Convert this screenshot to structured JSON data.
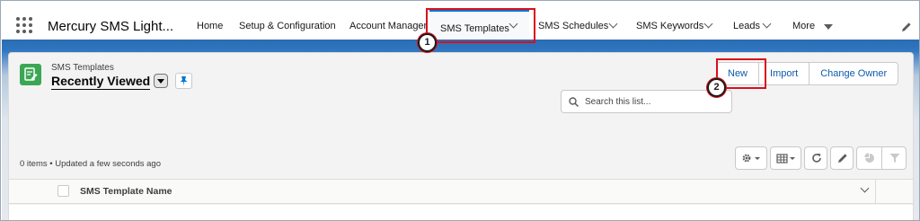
{
  "app": {
    "name": "Mercury SMS Light..."
  },
  "nav": {
    "items": [
      {
        "label": "Home"
      },
      {
        "label": "Setup & Configuration"
      },
      {
        "label": "Account Manager"
      },
      {
        "label": "SMS Templates"
      },
      {
        "label": "SMS Schedules"
      },
      {
        "label": "SMS Keywords"
      },
      {
        "label": "Leads"
      },
      {
        "label": "More"
      }
    ],
    "active": "SMS Templates"
  },
  "list_view": {
    "object_label": "SMS Templates",
    "title": "Recently Viewed",
    "status": "0 items • Updated a few seconds ago",
    "search_placeholder": "Search this list..."
  },
  "actions": {
    "new_label": "New",
    "import_label": "Import",
    "change_owner_label": "Change Owner"
  },
  "table": {
    "columns": [
      "SMS Template Name"
    ],
    "rows": []
  },
  "callouts": [
    "1",
    "2"
  ],
  "colors": {
    "accent": "#0176d3",
    "object_icon": "#3ba755",
    "callout": "#d9101b"
  }
}
